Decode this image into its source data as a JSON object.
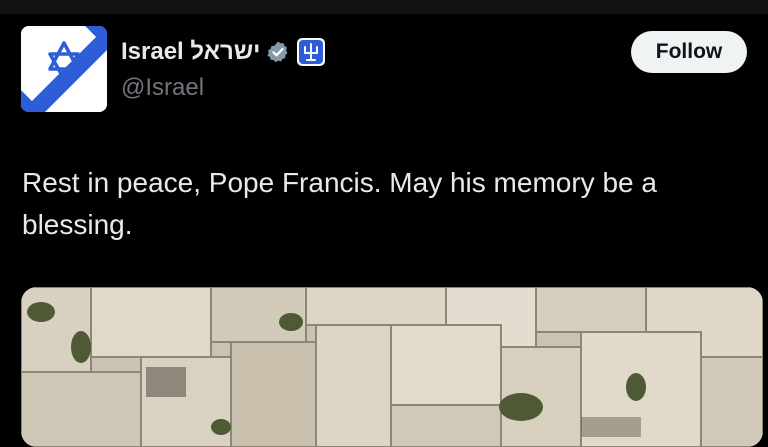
{
  "account": {
    "display_name": "Israel ישראל",
    "handle": "@Israel",
    "verified_icon": "verified-badge-icon",
    "affiliation_icon": "government-emblem-icon"
  },
  "follow_label": "Follow",
  "tweet": {
    "text": "Rest in peace, Pope Francis. May his memory be a blessing."
  },
  "colors": {
    "background": "#000000",
    "text_primary": "#e7e9ea",
    "text_secondary": "#71767b",
    "follow_bg": "#eff3f4",
    "flag_blue": "#2d5ed8",
    "verified_gray": "#829aab"
  },
  "media": {
    "subject": "stone-wall-photo"
  }
}
